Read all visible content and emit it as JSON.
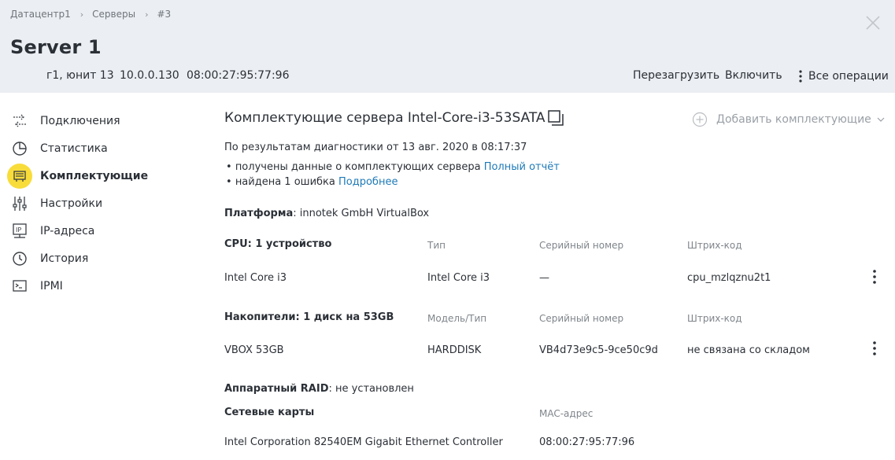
{
  "breadcrumbs": [
    "Датацентр1",
    "Серверы",
    "#3"
  ],
  "header": {
    "title": "Server 1",
    "location": "г1, юнит 13",
    "ip": "10.0.0.130",
    "mac": "08:00:27:95:77:96",
    "actions": {
      "reboot": "Перезагрузить",
      "power_on": "Включить",
      "all_ops": "Все операции"
    }
  },
  "sidebar": {
    "active_index": 2,
    "items": [
      {
        "label": "Подключения",
        "icon": "connections-icon"
      },
      {
        "label": "Статистика",
        "icon": "pie-chart-icon"
      },
      {
        "label": "Комплектующие",
        "icon": "components-icon"
      },
      {
        "label": "Настройки",
        "icon": "sliders-icon"
      },
      {
        "label": "IP-адреса",
        "icon": "ip-icon"
      },
      {
        "label": "История",
        "icon": "history-icon"
      },
      {
        "label": "IPMI",
        "icon": "terminal-icon"
      }
    ]
  },
  "main": {
    "title": "Комплектующие сервера Intel-Core-i3-53SATA",
    "add_label": "Добавить комплектующие",
    "diag_text": "По результатам диагностики от 13 авг. 2020 в 08:17:37",
    "bullets": [
      {
        "text": "получены данные о комплектующих сервера",
        "link": "Полный отчёт"
      },
      {
        "text": "найдена 1 ошибка",
        "link": "Подробнее"
      }
    ],
    "platform": {
      "label": "Платформа",
      "value": ": innotek GmbH VirtualBox"
    },
    "cpu": {
      "heading": "CPU: 1 устройство",
      "cols": [
        "Тип",
        "Серийный номер",
        "Штрих-код"
      ],
      "row": {
        "name": "Intel Core i3",
        "type": "Intel Core i3",
        "serial": "—",
        "barcode": "cpu_mzlqznu2t1"
      }
    },
    "storage": {
      "heading": "Накопители: 1 диск на 53GB",
      "cols": [
        "Модель/Тип",
        "Серийный номер",
        "Штрих-код"
      ],
      "row": {
        "name": "VBOX 53GB",
        "type": "HARDDISK",
        "serial": "VB4d73e9c5-9ce50c9d",
        "barcode": "не связана со складом"
      }
    },
    "raid": {
      "label": "Аппаратный RAID",
      "value": ": не установлен"
    },
    "nics": {
      "heading": "Сетевые карты",
      "col_mac": "MAC-адрес",
      "row": {
        "name": "Intel Corporation 82540EM Gigabit Ethernet Controller",
        "mac": "08:00:27:95:77:96"
      }
    }
  },
  "colors": {
    "header_bg": "#ebeef2",
    "accent_yellow": "#f8dc3a",
    "link": "#1e7ab8"
  }
}
